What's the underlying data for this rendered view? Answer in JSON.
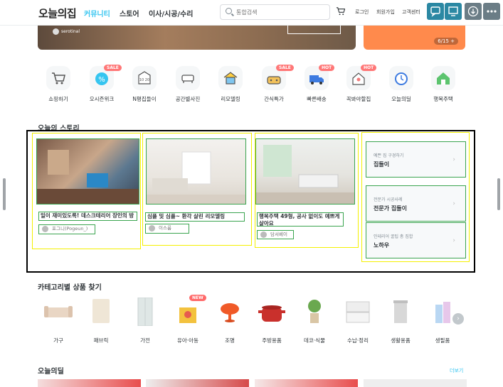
{
  "header": {
    "logo": "오늘의집",
    "nav": [
      "커뮤니티",
      "스토어",
      "이사/시공/수리"
    ],
    "search_placeholder": "통합검색",
    "links": [
      "로그인",
      "회원가입",
      "고객센터"
    ],
    "float_icons": [
      "chat-icon",
      "desktop-icon",
      "download-icon",
      "more-icon"
    ]
  },
  "banner": {
    "user": "serotinal",
    "side_counter": "6/15 +"
  },
  "quick_menu": [
    {
      "label": "쇼핑하기",
      "icon": "cart-icon",
      "badge": ""
    },
    {
      "label": "오시즌위크",
      "icon": "percent-icon",
      "badge": "SALE"
    },
    {
      "label": "N평집들이",
      "icon": "house-size-icon",
      "badge": ""
    },
    {
      "label": "공간별사진",
      "icon": "sofa-icon",
      "badge": ""
    },
    {
      "label": "리모델링",
      "icon": "remodel-icon",
      "badge": ""
    },
    {
      "label": "간식특가",
      "icon": "snack-icon",
      "badge": "SALE"
    },
    {
      "label": "빠른배송",
      "icon": "truck-icon",
      "badge": "HOT"
    },
    {
      "label": "꼭봐야할집",
      "icon": "house-icon",
      "badge": "HOT"
    },
    {
      "label": "오늘의딜",
      "icon": "clock-icon",
      "badge": ""
    },
    {
      "label": "행복주택",
      "icon": "home-green-icon",
      "badge": ""
    }
  ],
  "story": {
    "title": "오늘의 스토리",
    "cards": [
      {
        "title": "일이 재미있도록! 데스크테리어 장인의 방",
        "author": "포그니(Pogeun_)"
      },
      {
        "title": "심플 및 심플~ 환각 살린 리모델링",
        "author": "이스룸"
      },
      {
        "title": "행복주택 49형, 공사 없이도 예쁘게 살아요",
        "author": "담서베이"
      }
    ],
    "side": [
      {
        "small": "예쁜 집 구경하기",
        "big": "집들이"
      },
      {
        "small": "전문가 시공사례",
        "big": "전문가 집들이"
      },
      {
        "small": "인테리어 꿀팁 총 집합",
        "big": "노하우"
      }
    ]
  },
  "category": {
    "title": "카테고리별 상품 찾기",
    "items": [
      {
        "label": "가구",
        "badge": ""
      },
      {
        "label": "패브릭",
        "badge": ""
      },
      {
        "label": "가전",
        "badge": ""
      },
      {
        "label": "유아·아동",
        "badge": "NEW"
      },
      {
        "label": "조명",
        "badge": ""
      },
      {
        "label": "주방용품",
        "badge": ""
      },
      {
        "label": "데코·식물",
        "badge": ""
      },
      {
        "label": "수납·정리",
        "badge": ""
      },
      {
        "label": "생활용품",
        "badge": ""
      },
      {
        "label": "생필품",
        "badge": ""
      }
    ]
  },
  "deal": {
    "title": "오늘의딜",
    "more": "더보기"
  },
  "colors": {
    "accent": "#35c5f0",
    "annotation_green": "#3aa44f",
    "annotation_yellow": "#f4f000"
  }
}
